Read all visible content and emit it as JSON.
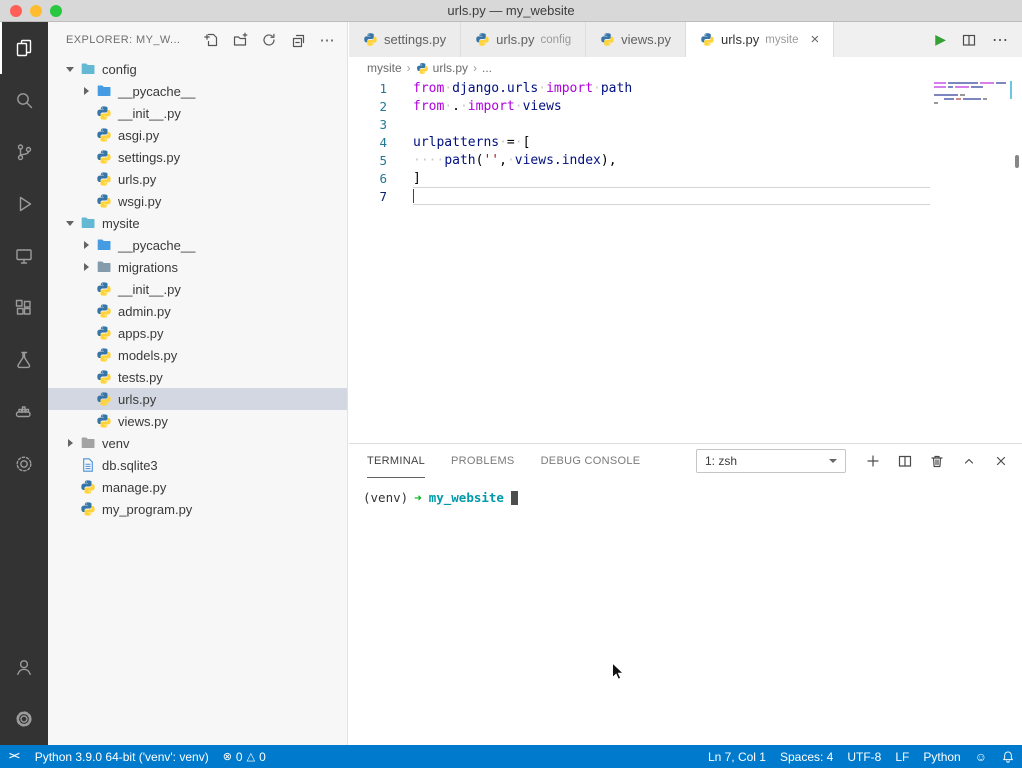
{
  "window": {
    "title": "urls.py — my_website"
  },
  "activity_bar": {
    "items": [
      "explorer",
      "search",
      "source-control",
      "run-and-debug",
      "remote-explorer",
      "extensions",
      "testing",
      "docker",
      "kubernetes"
    ],
    "bottom": [
      "accounts",
      "settings"
    ]
  },
  "sidebar": {
    "title": "EXPLORER: MY_W...",
    "actions": [
      "new-file",
      "new-folder",
      "refresh-explorer",
      "collapse-folders",
      "more-actions"
    ],
    "tree": [
      {
        "label": "config"
      },
      {
        "label": "__pycache__"
      },
      {
        "label": "__init__.py"
      },
      {
        "label": "asgi.py"
      },
      {
        "label": "settings.py"
      },
      {
        "label": "urls.py"
      },
      {
        "label": "wsgi.py"
      },
      {
        "label": "mysite"
      },
      {
        "label": "__pycache__"
      },
      {
        "label": "migrations"
      },
      {
        "label": "__init__.py"
      },
      {
        "label": "admin.py"
      },
      {
        "label": "apps.py"
      },
      {
        "label": "models.py"
      },
      {
        "label": "tests.py"
      },
      {
        "label": "urls.py"
      },
      {
        "label": "views.py"
      },
      {
        "label": "venv"
      },
      {
        "label": "db.sqlite3"
      },
      {
        "label": "manage.py"
      },
      {
        "label": "my_program.py"
      }
    ]
  },
  "tabs": {
    "items": [
      {
        "label": "settings.py",
        "detail": ""
      },
      {
        "label": "urls.py",
        "detail": "config"
      },
      {
        "label": "views.py",
        "detail": ""
      },
      {
        "label": "urls.py",
        "detail": "mysite"
      }
    ],
    "close_symbol": "×"
  },
  "icons": {
    "run": "▶",
    "more": "⋯",
    "breadcrumb_sep": "›",
    "error": "⊗",
    "warning": "△",
    "feedback": "☺",
    "plus": "+"
  },
  "breadcrumb": [
    "mysite",
    "urls.py",
    "..."
  ],
  "editor": {
    "lines": [
      {
        "num": "1",
        "tokens": [
          {
            "text": "from",
            "cls": "kw"
          },
          {
            "text": "·",
            "cls": "ws"
          },
          {
            "text": "django.urls",
            "cls": "name"
          },
          {
            "text": "·",
            "cls": "ws"
          },
          {
            "text": "import",
            "cls": "kw"
          },
          {
            "text": "·",
            "cls": "ws"
          },
          {
            "text": "path",
            "cls": "name"
          }
        ]
      },
      {
        "num": "2",
        "tokens": [
          {
            "text": "from",
            "cls": "kw"
          },
          {
            "text": "·",
            "cls": "ws"
          },
          {
            "text": ".",
            "cls": "plain"
          },
          {
            "text": "·",
            "cls": "ws"
          },
          {
            "text": "import",
            "cls": "kw"
          },
          {
            "text": "·",
            "cls": "ws"
          },
          {
            "text": "views",
            "cls": "name"
          }
        ]
      },
      {
        "num": "3",
        "tokens": []
      },
      {
        "num": "4",
        "tokens": [
          {
            "text": "urlpatterns",
            "cls": "name"
          },
          {
            "text": "·",
            "cls": "ws"
          },
          {
            "text": "=",
            "cls": "plain"
          },
          {
            "text": "·",
            "cls": "ws"
          },
          {
            "text": "[",
            "cls": "plain"
          }
        ]
      },
      {
        "num": "5",
        "tokens": [
          {
            "text": "····",
            "cls": "ws"
          },
          {
            "text": "path",
            "cls": "name"
          },
          {
            "text": "(",
            "cls": "plain"
          },
          {
            "text": "''",
            "cls": "str"
          },
          {
            "text": ",",
            "cls": "plain"
          },
          {
            "text": "·",
            "cls": "ws"
          },
          {
            "text": "views.index",
            "cls": "name"
          },
          {
            "text": ")",
            "cls": "plain"
          },
          {
            "text": ",",
            "cls": "plain"
          }
        ]
      },
      {
        "num": "6",
        "tokens": [
          {
            "text": "]",
            "cls": "plain"
          }
        ]
      },
      {
        "num": "7",
        "tokens": []
      }
    ]
  },
  "panel": {
    "tabs": [
      "TERMINAL",
      "PROBLEMS",
      "DEBUG CONSOLE"
    ],
    "shell": "1: zsh",
    "actions": [
      "new-terminal",
      "split-terminal",
      "kill-terminal",
      "maximize-panel",
      "close-panel"
    ],
    "terminal": {
      "venv": "(venv)",
      "arrow": "➜",
      "cwd": "my_website"
    }
  },
  "status_bar": {
    "remote": "><",
    "python": "Python 3.9.0 64-bit ('venv': venv)",
    "errors": "0",
    "warnings": "0",
    "cursor": "Ln 7, Col 1",
    "indent": "Spaces: 4",
    "encoding": "UTF-8",
    "eol": "LF",
    "language": "Python"
  },
  "colors": {
    "status_bar": "#007acc",
    "keyword": "#af00db",
    "identifier": "#001080",
    "string": "#a31515",
    "selection": "#d2d7e2",
    "python_blue": "#3775a9",
    "python_yellow": "#ffd43b",
    "run_button": "#33a133"
  }
}
